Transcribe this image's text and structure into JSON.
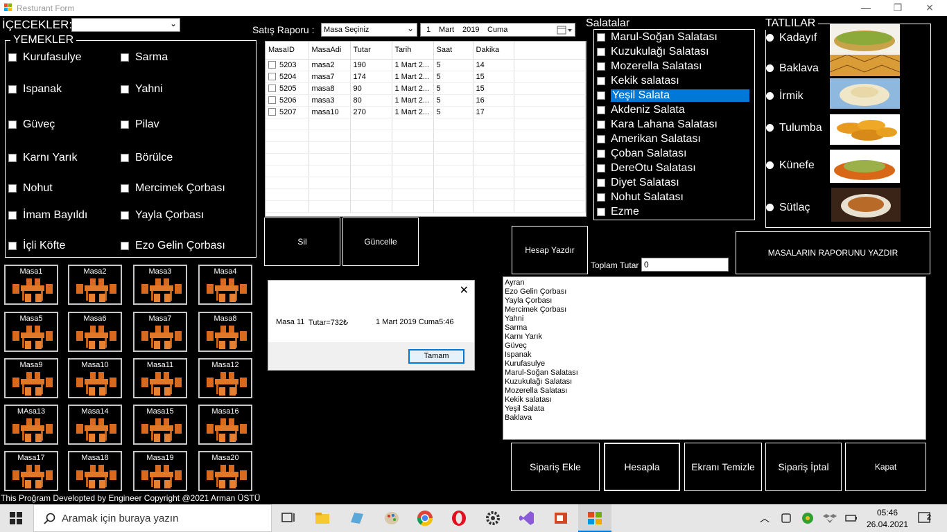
{
  "window": {
    "title": "Resturant Form",
    "minimize": "—",
    "restore": "❐",
    "close": "✕"
  },
  "icecekler": {
    "label": "İÇECEKLER:",
    "value": ""
  },
  "yemekler": {
    "title": "YEMEKLER",
    "items": [
      "Kurufasulye",
      "Sarma",
      "Ispanak",
      "Yahni",
      "Güveç",
      "Pilav",
      "Karnı Yarık",
      "Börülce",
      "Nohut",
      "Mercimek Çorbası",
      "İmam Bayıldı",
      "Yayla Çorbası",
      "İçli Köfte",
      "Ezo Gelin Çorbası"
    ]
  },
  "masalar": [
    "Masa1",
    "Masa2",
    "Masa3",
    "Masa4",
    "Masa5",
    "Masa6",
    "Masa7",
    "Masa8",
    "Masa9",
    "Masa10",
    "Masa11",
    "Masa12",
    "MAsa13",
    "Masa14",
    "Masa15",
    "Masa16",
    "Masa17",
    "Masa18",
    "Masa19",
    "Masa20"
  ],
  "report": {
    "label": "Satış Raporu :",
    "table_select": "Masa Seçiniz",
    "date": {
      "day": "1",
      "month": "Mart",
      "year": "2019",
      "weekday": "Cuma"
    },
    "columns": [
      "MasaID",
      "MasaAdi",
      "Tutar",
      "Tarih",
      "Saat",
      "Dakika"
    ],
    "rows": [
      [
        "5203",
        "masa2",
        "190",
        "1 Mart 2...",
        "5",
        "14"
      ],
      [
        "5204",
        "masa7",
        "174",
        "1 Mart 2...",
        "5",
        "15"
      ],
      [
        "5205",
        "masa8",
        "90",
        "1 Mart 2...",
        "5",
        "15"
      ],
      [
        "5206",
        "masa3",
        "80",
        "1 Mart 2...",
        "5",
        "16"
      ],
      [
        "5207",
        "masa10",
        "270",
        "1 Mart 2...",
        "5",
        "17"
      ]
    ],
    "delete_label": "Sil",
    "update_label": "Güncelle"
  },
  "dialog": {
    "masa": "Masa 11",
    "tutar": "Tutar=732₺",
    "date": "1 Mart 2019 Cuma5:46",
    "ok_label": "Tamam",
    "close": "✕"
  },
  "salatalar": {
    "title": "Salatalar",
    "items": [
      "Marul-Soğan Salatası",
      "Kuzukulağı Salatası",
      "Mozerella Salatası",
      "Kekik salatası",
      "Yeşil Salata",
      "Akdeniz Salata",
      "Kara Lahana Salatası",
      "Amerikan Salatası",
      "Çoban Salatası",
      "DereOtu Salatası",
      "Diyet  Salatası",
      "Nohut Salatası",
      "Ezme"
    ],
    "selected_index": 4,
    "selected_color": "#0078d7"
  },
  "tatlilar": {
    "title": "TATLILAR",
    "items": [
      "Kadayıf",
      "Baklava",
      "İrmik",
      "Tulumba",
      "Künefe",
      "Sütlaç"
    ]
  },
  "actions": {
    "hesap_yazdir": "Hesap Yazdır",
    "toplam_label": "Toplam Tutar :",
    "toplam_value": "0",
    "rapor_yazdir": "MASALARIN RAPORUNU YAZDIR",
    "siparis_ekle": "Sipariş Ekle",
    "hesapla": "Hesapla",
    "temizle": "Ekranı Temizle",
    "iptal": "Sipariş İptal",
    "kapat": "Kapat"
  },
  "orders": [
    "Ayran",
    "Ezo Gelin Çorbası",
    "Yayla Çorbası",
    "Mercimek Çorbası",
    "Yahni",
    "Sarma",
    "Karnı Yarık",
    "Güveç",
    "Ispanak",
    "Kurufasulye",
    "Marul-Soğan Salatası",
    "Kuzukulağı Salatası",
    "Mozerella Salatası",
    "Kekik salatası",
    "Yeşil Salata",
    "Baklava"
  ],
  "footer": "This Proğram Developted by Engineer Copyright @2021 Arman ÜSTÜ",
  "taskbar": {
    "search_placeholder": "Aramak için buraya yazın",
    "time": "05:46",
    "date": "26.04.2021",
    "notifications": "2"
  }
}
